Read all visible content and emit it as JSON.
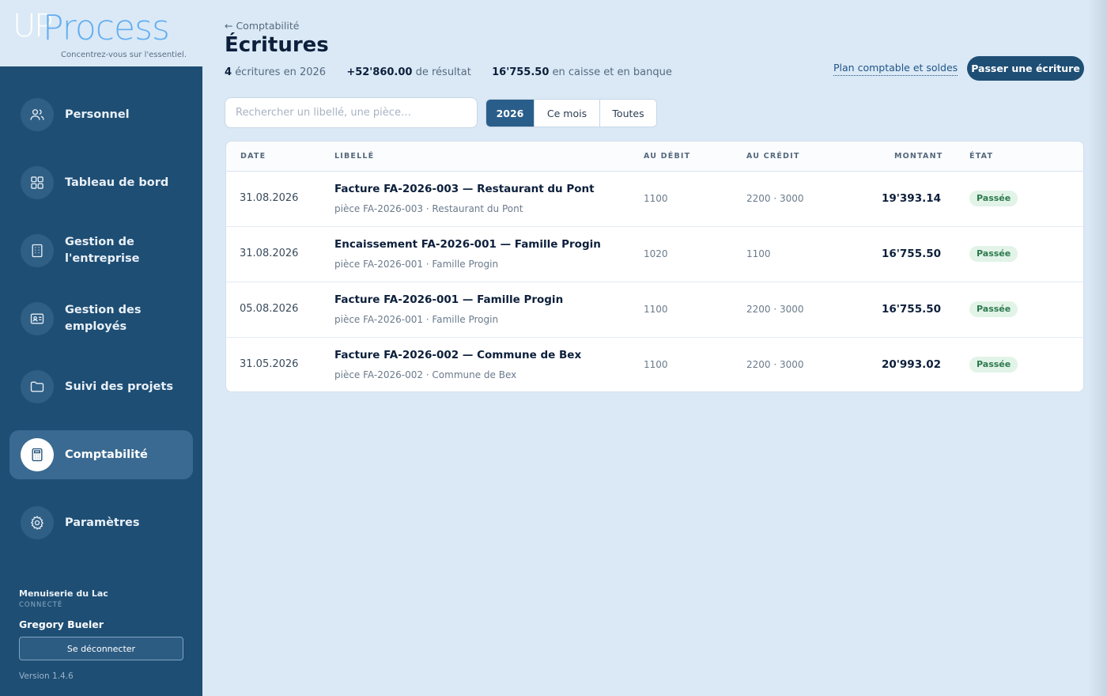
{
  "brand": {
    "logo_up": "UP",
    "logo_process": "Process",
    "tagline": "Concentrez-vous sur l'essentiel."
  },
  "sidebar": {
    "items": [
      {
        "label": "Personnel",
        "icon": "users-icon"
      },
      {
        "label": "Tableau de bord",
        "icon": "grid-icon"
      },
      {
        "label": "Gestion de l'entreprise",
        "icon": "building-icon"
      },
      {
        "label": "Gestion des employés",
        "icon": "id-card-icon"
      },
      {
        "label": "Suivi des projets",
        "icon": "folder-icon"
      },
      {
        "label": "Comptabilité",
        "icon": "calculator-icon",
        "active": true
      },
      {
        "label": "Paramètres",
        "icon": "gear-icon"
      }
    ],
    "company": "Menuiserie du Lac",
    "connected_label": "CONNECTÉ",
    "user": "Gregory Bueler",
    "logout_label": "Se déconnecter",
    "version": "Version 1.4.6"
  },
  "header": {
    "breadcrumb": "← Comptabilité",
    "title": "Écritures",
    "stats": {
      "count": "4",
      "count_text": "écritures en 2026",
      "result": "+52'860.00",
      "result_text": "de résultat",
      "cash": "16'755.50",
      "cash_text": "en caisse et en banque"
    },
    "plan_link": "Plan comptable et soldes",
    "primary_button": "Passer une écriture"
  },
  "filters": {
    "search_placeholder": "Rechercher un libellé, une pièce…",
    "segments": [
      "2026",
      "Ce mois",
      "Toutes"
    ],
    "selected": "2026"
  },
  "table": {
    "columns": [
      "DATE",
      "LIBELLÉ",
      "AU DÉBIT",
      "AU CRÉDIT",
      "MONTANT",
      "ÉTAT"
    ],
    "rows": [
      {
        "date": "31.08.2026",
        "title": "Facture FA-2026-003 — Restaurant du Pont",
        "sub": "pièce FA-2026-003 · Restaurant du Pont",
        "debit": "1100",
        "credit": "2200 · 3000",
        "amount": "19'393.14",
        "status": "Passée"
      },
      {
        "date": "31.08.2026",
        "title": "Encaissement FA-2026-001 — Famille Progin",
        "sub": "pièce FA-2026-001 · Famille Progin",
        "debit": "1020",
        "credit": "1100",
        "amount": "16'755.50",
        "status": "Passée"
      },
      {
        "date": "05.08.2026",
        "title": "Facture FA-2026-001 — Famille Progin",
        "sub": "pièce FA-2026-001 · Famille Progin",
        "debit": "1100",
        "credit": "2200 · 3000",
        "amount": "16'755.50",
        "status": "Passée"
      },
      {
        "date": "31.05.2026",
        "title": "Facture FA-2026-002 — Commune de Bex",
        "sub": "pièce FA-2026-002 · Commune de Bex",
        "debit": "1100",
        "credit": "2200 · 3000",
        "amount": "20'993.02",
        "status": "Passée"
      }
    ]
  },
  "colors": {
    "sidebar_bg": "#1e4e74",
    "page_bg": "#dbe9f6",
    "accent": "#2a5e8a",
    "badge_bg": "#e2f3e8",
    "badge_text": "#2d7a4d"
  }
}
